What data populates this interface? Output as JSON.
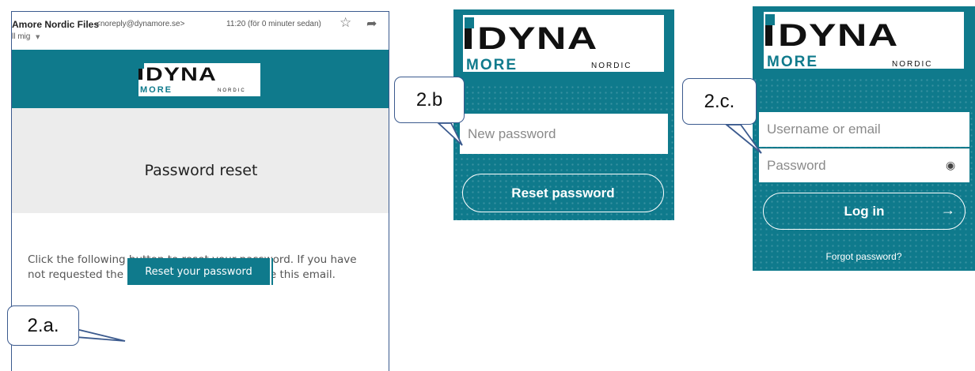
{
  "email": {
    "sender_name": "Amore Nordic Files",
    "sender_address": "<noreply@dynamore.se>",
    "time": "11:20 (för 0 minuter sedan)",
    "recipient": "ll mig",
    "title": "Password reset",
    "body": "Click the following button to reset your password. If you have not requested the password reset, then ignore this email.",
    "button_label": "Reset your password",
    "icons": {
      "star": "star-icon",
      "reply": "reply-icon",
      "caret": "caret-down-icon"
    }
  },
  "logo": {
    "line1": "DYNA",
    "line2": "MORE",
    "line3": "NORDIC"
  },
  "reset_page": {
    "new_password_placeholder": "New password",
    "button_label": "Reset password"
  },
  "login_page": {
    "username_placeholder": "Username or email",
    "password_placeholder": "Password",
    "button_label": "Log in",
    "forgot_link": "Forgot password?",
    "icons": {
      "eye": "eye-icon",
      "arrow": "arrow-right-icon"
    }
  },
  "callouts": {
    "a": "2.a.",
    "b": "2.b",
    "c": "2.c."
  },
  "colors": {
    "teal": "#0f7a8c",
    "callout_border": "#3b5a8e"
  }
}
